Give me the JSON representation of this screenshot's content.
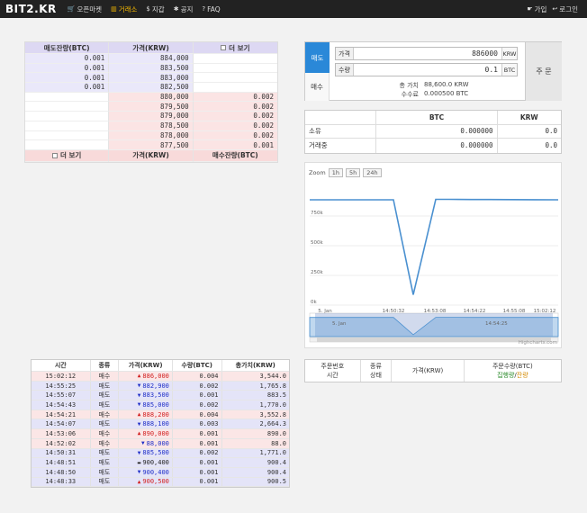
{
  "nav": {
    "brand": "BIT2.KR",
    "links": [
      {
        "label": "오픈마켓",
        "icon": "cart-icon",
        "glyph": "🛒"
      },
      {
        "label": "거래소",
        "icon": "bar-chart-icon",
        "glyph": "▥"
      },
      {
        "label": "지갑",
        "icon": "dollar-icon",
        "glyph": "$"
      },
      {
        "label": "공지",
        "icon": "gear-icon",
        "glyph": "✱"
      },
      {
        "label": "FAQ",
        "icon": "question-icon",
        "glyph": "?"
      }
    ],
    "right": [
      {
        "label": "가입",
        "icon": "hand-icon",
        "glyph": "☛"
      },
      {
        "label": "로그인",
        "icon": "login-icon",
        "glyph": "↩"
      }
    ],
    "active_color": "#f5b800"
  },
  "orderbook": {
    "ask_header": [
      "매도잔량(BTC)",
      "가격(KRW)",
      "더 보기"
    ],
    "asks": [
      {
        "qty": "0.001",
        "price": "884,000"
      },
      {
        "qty": "0.001",
        "price": "883,500"
      },
      {
        "qty": "0.001",
        "price": "883,000"
      },
      {
        "qty": "0.001",
        "price": "882,500"
      }
    ],
    "bids": [
      {
        "price": "880,000",
        "qty": "0.002"
      },
      {
        "price": "879,500",
        "qty": "0.002"
      },
      {
        "price": "879,000",
        "qty": "0.002"
      },
      {
        "price": "878,500",
        "qty": "0.002"
      },
      {
        "price": "878,000",
        "qty": "0.002"
      },
      {
        "price": "877,500",
        "qty": "0.001"
      }
    ],
    "bid_footer": [
      "더 보기",
      "가격(KRW)",
      "매수잔량(BTC)"
    ]
  },
  "order_form": {
    "tab_sell": "매도",
    "tab_buy": "매수",
    "price_label": "가격",
    "price_value": "886000",
    "price_unit": "KRW",
    "qty_label": "수량",
    "qty_value": "0.1",
    "qty_unit": "BTC",
    "total_label": "총 가치",
    "total_value": "88,600.0 KRW",
    "fee_label": "수수료",
    "fee_value": "0.000500 BTC",
    "submit_label": "주 문",
    "sell_color": "#2a88d8"
  },
  "balance": {
    "header": [
      "",
      "BTC",
      "KRW"
    ],
    "rows": [
      {
        "label": "소유",
        "btc": "0.000000",
        "krw": "0.0"
      },
      {
        "label": "거래중",
        "btc": "0.000000",
        "krw": "0.0"
      }
    ]
  },
  "chart": {
    "zoom_label": "Zoom",
    "zoom_buttons": [
      "1h",
      "5h",
      "24h"
    ],
    "credit": "Highcharts.com",
    "nav_label": "5. Jan",
    "nav_time": "14:54:25"
  },
  "chart_data": {
    "type": "line",
    "x": [
      "14:46:00",
      "14:48:00",
      "14:50:32",
      "14:51:00",
      "14:52:02",
      "14:53:06",
      "14:54:00",
      "14:55:07",
      "14:56:00",
      "14:58:00",
      "15:00:00",
      "15:02:12"
    ],
    "values": [
      886000,
      886500,
      886500,
      886000,
      88000,
      890000,
      890000,
      889000,
      888500,
      888000,
      887500,
      886000
    ],
    "y_ticks": [
      "0k",
      "250k",
      "500k",
      "750k"
    ],
    "x_ticks": [
      "5. Jan",
      "14:50:32",
      "14:53:08",
      "14:54:22",
      "14:55:08",
      "15:02:12"
    ],
    "ylim": [
      0,
      1000000
    ],
    "line_color": "#4a90d0",
    "grid": true
  },
  "trades": {
    "header": [
      "시간",
      "종류",
      "가격(KRW)",
      "수량(BTC)",
      "총가치(KRW)"
    ],
    "rows": [
      {
        "time": "15:02:12",
        "type": "매수",
        "dir": "up",
        "price": "886,000",
        "qty": "0.004",
        "total": "3,544.0"
      },
      {
        "time": "14:55:25",
        "type": "매도",
        "dir": "down",
        "price": "882,900",
        "qty": "0.002",
        "total": "1,765.8"
      },
      {
        "time": "14:55:07",
        "type": "매도",
        "dir": "down",
        "price": "883,500",
        "qty": "0.001",
        "total": "883.5"
      },
      {
        "time": "14:54:43",
        "type": "매도",
        "dir": "down",
        "price": "885,000",
        "qty": "0.002",
        "total": "1,770.0"
      },
      {
        "time": "14:54:21",
        "type": "매수",
        "dir": "up",
        "price": "888,200",
        "qty": "0.004",
        "total": "3,552.8"
      },
      {
        "time": "14:54:07",
        "type": "매도",
        "dir": "down",
        "price": "888,100",
        "qty": "0.003",
        "total": "2,664.3"
      },
      {
        "time": "14:53:06",
        "type": "매수",
        "dir": "up",
        "price": "890,000",
        "qty": "0.001",
        "total": "890.0"
      },
      {
        "time": "14:52:02",
        "type": "매수",
        "dir": "down",
        "price": "88,000",
        "qty": "0.001",
        "total": "88.0"
      },
      {
        "time": "14:50:31",
        "type": "매도",
        "dir": "down",
        "price": "885,500",
        "qty": "0.002",
        "total": "1,771.0"
      },
      {
        "time": "14:48:51",
        "type": "매도",
        "dir": "flat",
        "price": "900,400",
        "qty": "0.001",
        "total": "900.4"
      },
      {
        "time": "14:48:50",
        "type": "매도",
        "dir": "down",
        "price": "900,400",
        "qty": "0.001",
        "total": "900.4"
      },
      {
        "time": "14:48:33",
        "type": "매도",
        "dir": "up",
        "price": "900,500",
        "qty": "0.001",
        "total": "900.5"
      }
    ]
  },
  "orders": {
    "h0a": "주문번호",
    "h0b": "시간",
    "h1a": "종류",
    "h1b": "상태",
    "h2": "가격(KRW)",
    "h3a": "주문수량(BTC)",
    "h3b_filled": "집행량",
    "h3b_sep": "/",
    "h3b_remain": "잔량"
  }
}
